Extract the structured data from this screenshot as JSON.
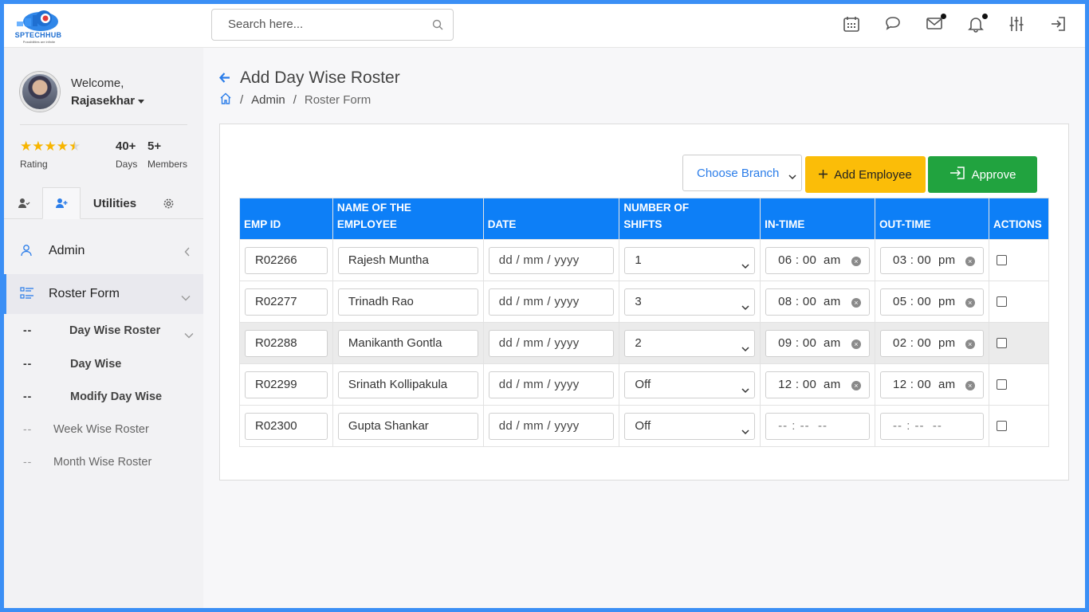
{
  "brand": {
    "name": "SPTECHHUB",
    "tagline": "Possibilities are infinite"
  },
  "search": {
    "placeholder": "Search here..."
  },
  "header_icons": [
    "calendar-icon",
    "chat-icon",
    "mail-icon",
    "bell-icon",
    "sliders-icon",
    "logout-icon"
  ],
  "user": {
    "welcome": "Welcome,",
    "name": "Rajasekhar"
  },
  "stats": {
    "rating_label": "Rating",
    "rating_value": 4.5,
    "days_value": "40+",
    "days_label": "Days",
    "members_value": "5+",
    "members_label": "Members"
  },
  "sidebar_tabs": {
    "utilities": "Utilities"
  },
  "menu": {
    "admin": "Admin",
    "roster_form": "Roster Form",
    "subitems": [
      "Day Wise Roster",
      "Day Wise",
      "Modify Day Wise",
      "Week Wise Roster",
      "Month Wise Roster"
    ]
  },
  "page": {
    "title": "Add Day Wise Roster"
  },
  "breadcrumb": {
    "admin": "Admin",
    "current": "Roster Form"
  },
  "toolbar": {
    "branch_select": "Choose Branch",
    "add_employee": "Add Employee",
    "approve": "Approve"
  },
  "table": {
    "headers": [
      "EMP ID",
      "NAME OF THE EMPLOYEE",
      "DATE",
      "NUMBER OF SHIFTS",
      "IN-TIME",
      "OUT-TIME",
      "ACTIONS"
    ],
    "header_lines": {
      "name_1": "NAME OF THE",
      "name_2": "EMPLOYEE",
      "shifts_1": "NUMBER OF",
      "shifts_2": "SHIFTS"
    },
    "date_placeholder": "dd / mm / yyyy",
    "time_placeholder": "-- : --  --",
    "rows": [
      {
        "emp_id": "R02266",
        "name": "Rajesh Muntha",
        "shifts": "1",
        "in_time": "06 : 00  am",
        "out_time": "03 : 00  pm"
      },
      {
        "emp_id": "R02277",
        "name": "Trinadh Rao",
        "shifts": "3",
        "in_time": "08 : 00  am",
        "out_time": "05 : 00  pm"
      },
      {
        "emp_id": "R02288",
        "name": "Manikanth Gontla",
        "shifts": "2",
        "in_time": "09 : 00  am",
        "out_time": "02 : 00  pm"
      },
      {
        "emp_id": "R02299",
        "name": "Srinath Kollipakula",
        "shifts": "Off",
        "in_time": "12 : 00  am",
        "out_time": "12 : 00  am"
      },
      {
        "emp_id": "R02300",
        "name": "Gupta Shankar",
        "shifts": "Off",
        "in_time": "",
        "out_time": ""
      }
    ]
  },
  "colors": {
    "accent": "#0d7ff7",
    "warning": "#fbbd08",
    "success": "#21a33f",
    "star": "#f7b500"
  }
}
